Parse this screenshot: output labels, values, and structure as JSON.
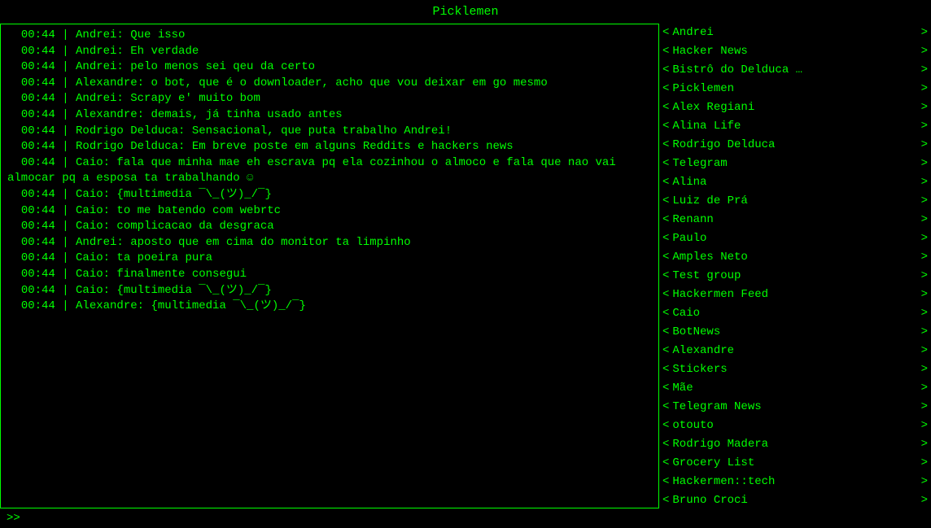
{
  "title": "Picklemen",
  "chat": {
    "lines": [
      "  00:44 | Andrei: Que isso",
      "  00:44 | Andrei: Eh verdade",
      "  00:44 | Andrei: pelo menos sei qeu da certo",
      "  00:44 | Alexandre: o bot, que é o downloader, acho que vou deixar em go mesmo",
      "  00:44 | Andrei: Scrapy e' muito bom",
      "  00:44 | Alexandre: demais, já tinha usado antes",
      "  00:44 | Rodrigo Delduca: Sensacional, que puta trabalho Andrei!",
      "  00:44 | Rodrigo Delduca: Em breve poste em alguns Reddits e hackers news",
      "  00:44 | Caio: fala que minha mae eh escrava pq ela cozinhou o almoco e fala que nao vai almocar pq a esposa ta trabalhando ☺",
      "  00:44 | Caio: {multimedia ¯\\_(ツ)_/¯}",
      "  00:44 | Caio: to me batendo com webrtc",
      "  00:44 | Caio: complicacao da desgraca",
      "  00:44 | Andrei: aposto que em cima do monitor ta limpinho",
      "  00:44 | Caio: ta poeira pura",
      "  00:44 | Caio: finalmente consegui",
      "  00:44 | Caio: {multimedia ¯\\_(ツ)_/¯}",
      "  00:44 | Alexandre: {multimedia ¯\\_(ツ)_/¯}"
    ]
  },
  "sidebar": {
    "items": [
      {
        "name": "Andrei"
      },
      {
        "name": "Hacker News"
      },
      {
        "name": "Bistrô do Delduca …"
      },
      {
        "name": "Picklemen"
      },
      {
        "name": "Alex Regiani"
      },
      {
        "name": "Alina Life"
      },
      {
        "name": "Rodrigo Delduca"
      },
      {
        "name": "Telegram"
      },
      {
        "name": "Alina"
      },
      {
        "name": "Luiz de Prá"
      },
      {
        "name": "Renann"
      },
      {
        "name": "Paulo"
      },
      {
        "name": "Amples Neto"
      },
      {
        "name": "Test group"
      },
      {
        "name": "Hackermen Feed"
      },
      {
        "name": "Caio"
      },
      {
        "name": "BotNews"
      },
      {
        "name": "Alexandre"
      },
      {
        "name": "Stickers"
      },
      {
        "name": "Mãe"
      },
      {
        "name": "Telegram News"
      },
      {
        "name": "otouto"
      },
      {
        "name": "Rodrigo Madera"
      },
      {
        "name": "Grocery List"
      },
      {
        "name": "Hackermen::tech"
      },
      {
        "name": "Bruno Croci"
      }
    ]
  },
  "prompt": ">>"
}
